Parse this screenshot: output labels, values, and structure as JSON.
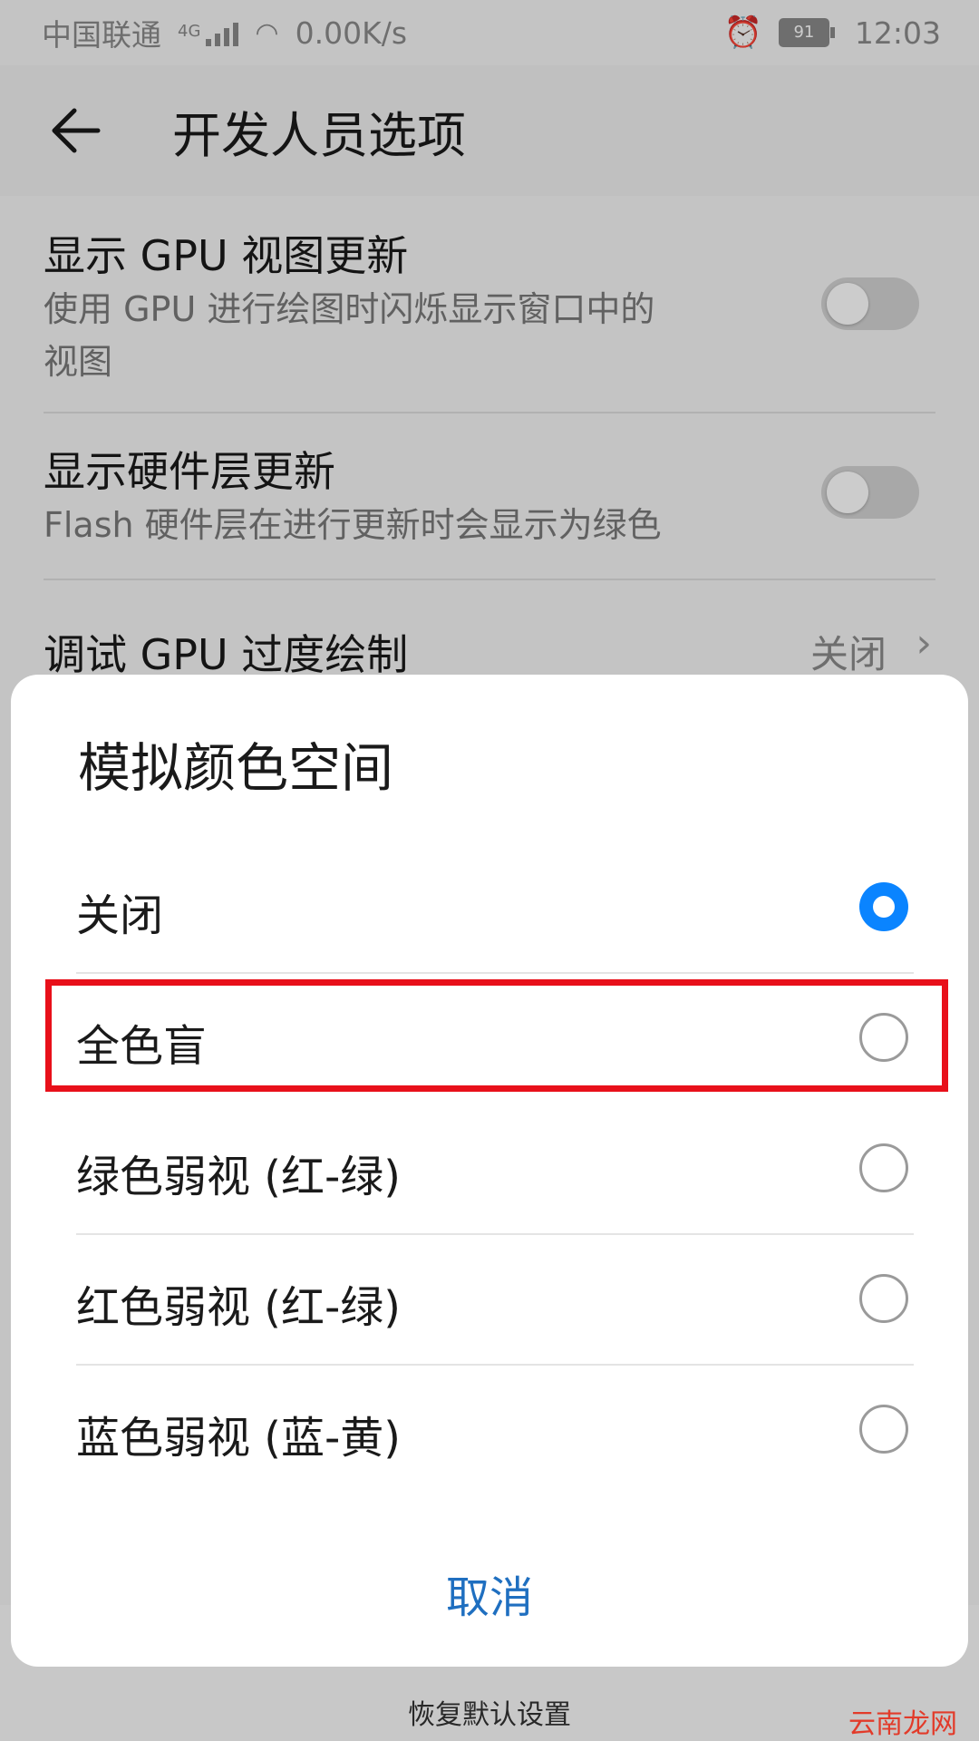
{
  "status_bar": {
    "carrier": "中国联通",
    "network": "4G",
    "speed": "0.00K/s",
    "battery": "91",
    "time": "12:03"
  },
  "header": {
    "title": "开发人员选项",
    "back_icon": "arrow-left-icon"
  },
  "settings": [
    {
      "title": "显示 GPU 视图更新",
      "subtitle_line1": "使用 GPU 进行绘图时闪烁显示窗口中的",
      "subtitle_line2": "视图",
      "toggle": false
    },
    {
      "title": "显示硬件层更新",
      "subtitle_line1": "Flash 硬件层在进行更新时会显示为绿色",
      "toggle": false
    },
    {
      "title": "调试 GPU 过度绘制",
      "value": "关闭"
    }
  ],
  "bottom": {
    "restore_label": "恢复默认设置"
  },
  "dialog": {
    "title": "模拟颜色空间",
    "options": [
      {
        "label": "关闭",
        "selected": true
      },
      {
        "label": "全色盲",
        "selected": false
      },
      {
        "label": "绿色弱视 (红-绿)",
        "selected": false
      },
      {
        "label": "红色弱视 (红-绿)",
        "selected": false
      },
      {
        "label": "蓝色弱视 (蓝-黄)",
        "selected": false
      }
    ],
    "cancel_label": "取消"
  },
  "watermark": "云南龙网",
  "colors": {
    "accent": "#0a84ff",
    "highlight_border": "#e8101a",
    "cancel_text": "#1f6fc0"
  }
}
